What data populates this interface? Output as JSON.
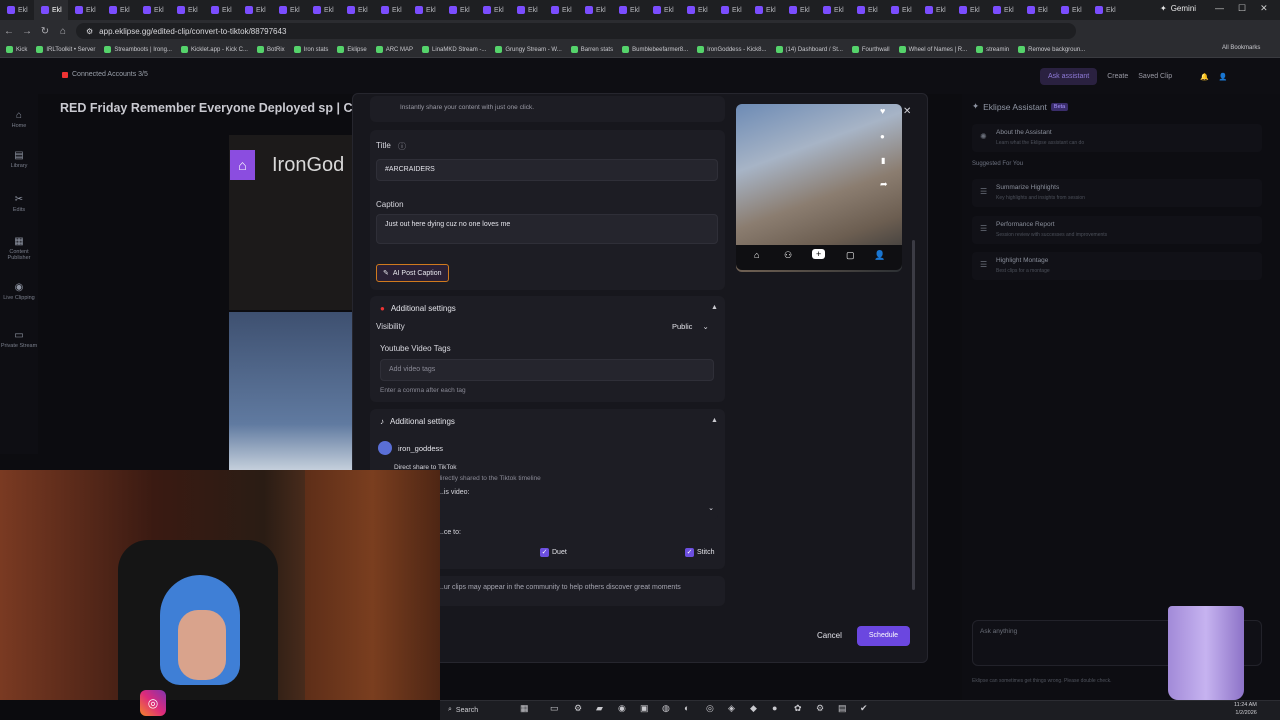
{
  "browser": {
    "tab_label": "Ekl",
    "tab_count": 33,
    "gemini_label": "Gemini",
    "url": "app.eklipse.gg/edited-clip/convert-to-tiktok/88797643",
    "bookmarks": [
      "Kick",
      "IRLToolkit • Server",
      "Streamboots | Irong...",
      "Kicklet.app - Kick C...",
      "BotRix",
      "Iron stats",
      "Eklipse",
      "ARC MAP",
      "LinaMKD Stream -...",
      "Grungy Stream - W...",
      "Barren stats",
      "Bumblebeefarmer8...",
      "IronGoddess - Kick8...",
      "(14) Dashboard / St...",
      "Fourthwall",
      "Wheel of Names | R...",
      "streamin",
      "Remove backgroun..."
    ],
    "all_bookmarks": "All Bookmarks"
  },
  "topnav": {
    "connected": "Connected Accounts 3/5",
    "ask_assistant": "Ask assistant",
    "create": "Create",
    "saved_clip": "Saved Clip"
  },
  "sidenav": [
    {
      "label": "Home",
      "icon": "home-icon"
    },
    {
      "label": "Library",
      "icon": "library-icon"
    },
    {
      "label": "Edits",
      "icon": "scissors-icon"
    },
    {
      "label": "Content Publisher",
      "icon": "calendar-icon"
    },
    {
      "label": "Live Clipping",
      "icon": "live-icon"
    },
    {
      "label": "Private Stream",
      "icon": "camera-icon"
    }
  ],
  "clip": {
    "title": "RED Friday Remember Everyone Deployed sp | Clip",
    "streamer_overlay": "IronGod"
  },
  "modal": {
    "share_hint": "Instantly share your content with just one click.",
    "title_label": "Title",
    "title_value": "#ARCRAIDERS",
    "caption_label": "Caption",
    "caption_value": "Just out here dying cuz no one loves me",
    "ai_button": "AI Post Caption",
    "youtube": {
      "header": "Additional settings",
      "visibility_label": "Visibility",
      "visibility_value": "Public",
      "tags_label": "Youtube Video Tags",
      "tags_placeholder": "Add video tags",
      "tags_hint": "Enter a comma after each tag"
    },
    "tiktok": {
      "header": "Additional settings",
      "account": "iron_goddess",
      "direct_share": "Direct share to TikTok",
      "direct_share_hint": "...directly shared to the Tiktok timeline",
      "who_label": "...is video:",
      "allow_label": "...ce to:",
      "duet": "Duet",
      "stitch": "Stitch",
      "community": "...ur clips may appear in the community to help others discover great moments"
    },
    "cancel": "Cancel",
    "schedule": "Schedule"
  },
  "assistant": {
    "title": "Eklipse Assistant",
    "badge": "Beta",
    "about_title": "About the Assistant",
    "about_sub": "Learn what the Eklipse assistant can do",
    "suggested": "Suggested For You",
    "items": [
      {
        "title": "Summarize Highlights",
        "sub": "Key highlights and insights from session"
      },
      {
        "title": "Performance Report",
        "sub": "Session review with successes and improvements"
      },
      {
        "title": "Highlight Montage",
        "sub": "Best clips for a montage"
      }
    ],
    "input_placeholder": "Ask anything",
    "disclaimer": "Eklipse can sometimes get things wrong. Please double check."
  },
  "taskbar": {
    "search": "Search",
    "time": "11:24 AM",
    "date": "1/2/2026"
  }
}
